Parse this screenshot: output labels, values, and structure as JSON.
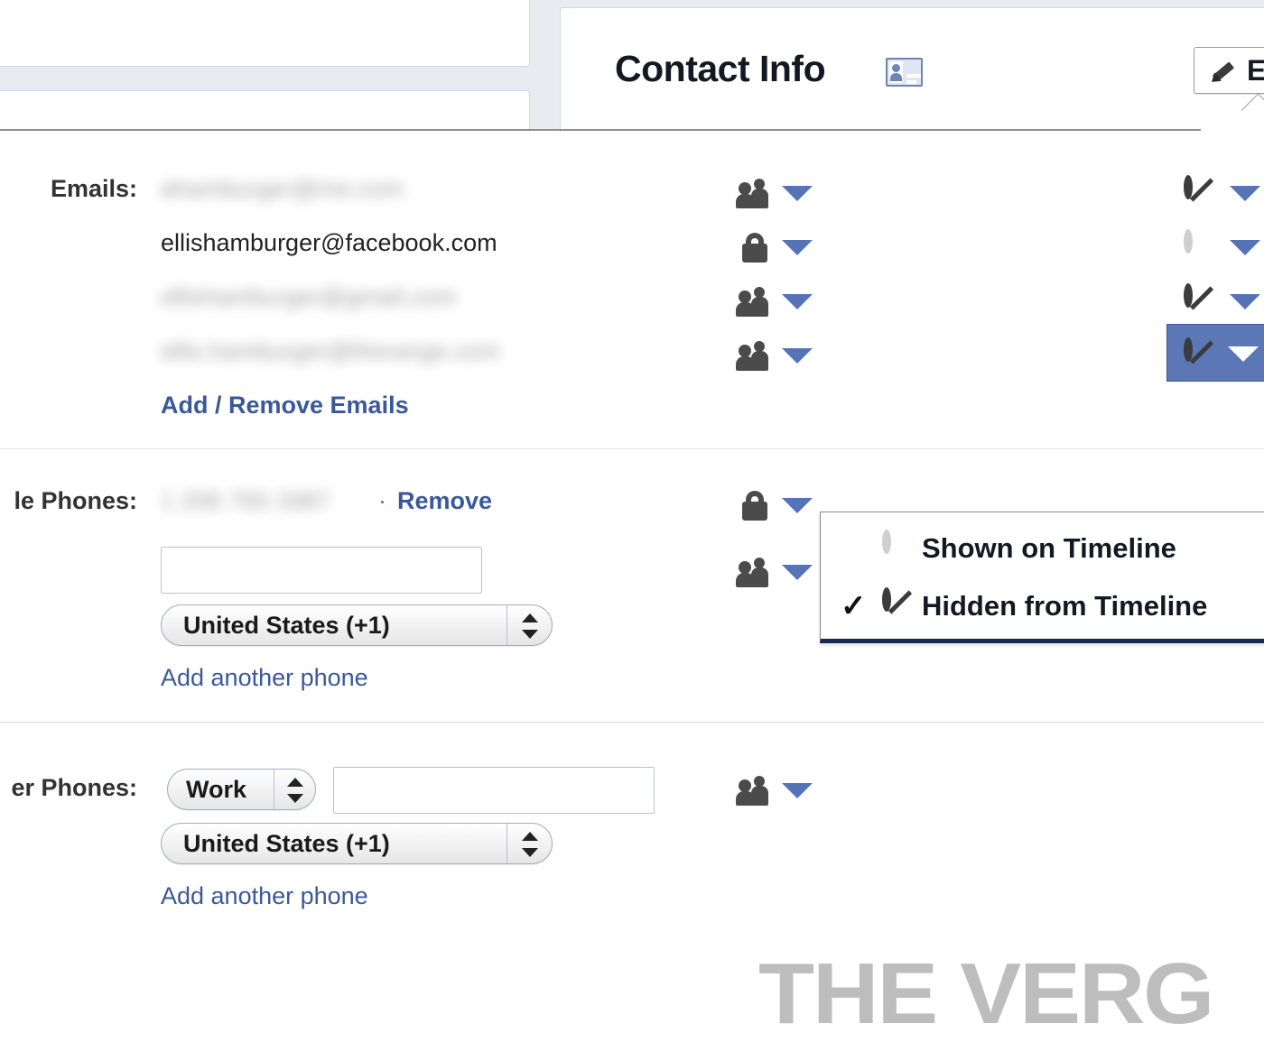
{
  "header": {
    "title": "Contact Info",
    "card_icon": "contact-card-icon",
    "edit_button_label": "Ed",
    "edit_button_full_label": "Edit",
    "pencil_icon": "pencil-icon"
  },
  "sections": {
    "emails": {
      "label": "Emails:",
      "rows": [
        {
          "value": "ahamburger@me.com",
          "blurred": true,
          "audience_icon": "friends-icon",
          "visibility_glyph": "hidden-icon",
          "highlighted": false
        },
        {
          "value": "ellishamburger@facebook.com",
          "blurred": false,
          "audience_icon": "lock-icon",
          "visibility_glyph": "shown-icon",
          "highlighted": false
        },
        {
          "value": "ellishamburger@gmail.com",
          "blurred": true,
          "audience_icon": "friends-icon",
          "visibility_glyph": "hidden-icon",
          "highlighted": false
        },
        {
          "value": "ellis.hamburger@theverge.com",
          "blurred": true,
          "audience_icon": "friends-icon",
          "visibility_glyph": "hidden-icon",
          "highlighted": true
        }
      ],
      "add_remove_link": "Add / Remove Emails"
    },
    "mobile_phones": {
      "label": "le Phones:",
      "full_label": "Mobile Phones:",
      "number": "1 206 765 3387",
      "number_blurred": true,
      "separator": "·",
      "remove_link": "Remove",
      "audience_icon": "lock-icon",
      "new_entry_audience_icon": "friends-icon",
      "phone_input_value": "",
      "country_select_value": "United States (+1)",
      "add_another_link": "Add another phone"
    },
    "other_phones": {
      "label": "er Phones:",
      "full_label": "Other Phones:",
      "type_select_value": "Work",
      "phone_input_value": "",
      "country_select_value": "United States (+1)",
      "audience_icon": "friends-icon",
      "add_another_link": "Add another phone"
    }
  },
  "dropdown_menu": {
    "visible": true,
    "items": [
      {
        "label": "Shown on Timeline",
        "glyph": "shown-icon",
        "checked": false
      },
      {
        "label": "Hidden from Timeline",
        "glyph": "hidden-icon",
        "checked": true,
        "check_mark": "✓"
      }
    ]
  },
  "watermark": {
    "text": "THE VERG",
    "full_text": "THE VERGE"
  },
  "colors": {
    "link_blue": "#3b5998",
    "highlight_blue": "#5b77b5",
    "menu_border_navy": "#1b2a55",
    "caret_blue": "#5573b7",
    "chrome_bg": "#e9ebf0",
    "watermark_gray": "#bdbdbd",
    "text_dark": "#141823"
  }
}
